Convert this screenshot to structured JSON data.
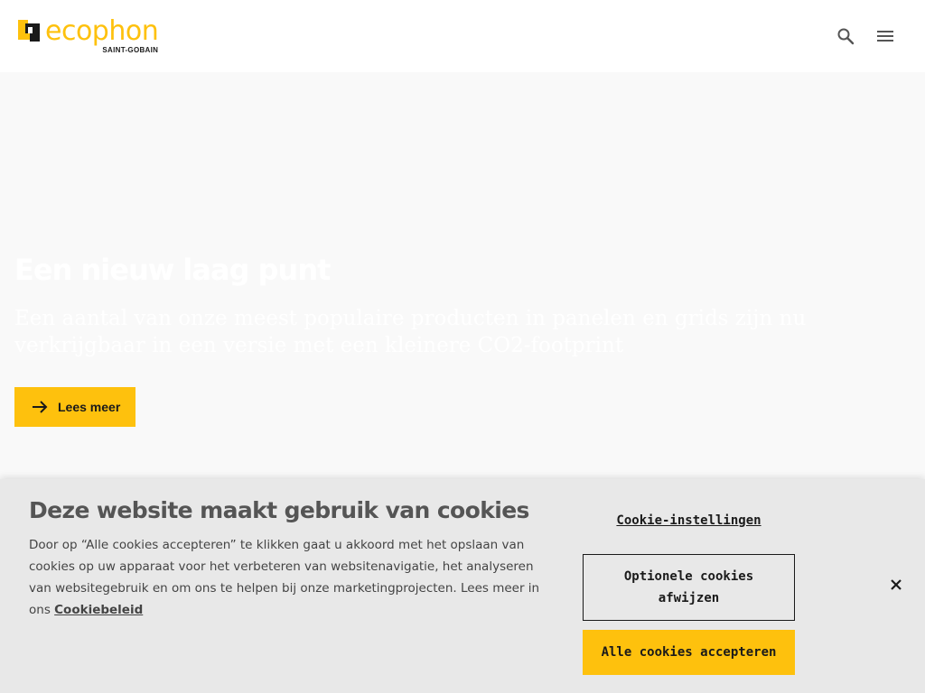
{
  "header": {
    "logo_word": "ecophon",
    "logo_sub": "SAINT-GOBAIN",
    "brand_color": "#fec10d",
    "search_icon": "search-icon",
    "menu_icon": "menu-icon"
  },
  "hero": {
    "title": "Een nieuw laag punt",
    "text": "Een aantal van onze meest populaire producten in panelen en grids zijn nu verkrijgbaar in een versie met een kleinere CO2-footprint",
    "button_label": "Lees meer",
    "button_icon": "arrow-right-icon"
  },
  "cookie_banner": {
    "title": "Deze website maakt gebruik van cookies",
    "body": "Door op “Alle cookies accepteren” te klikken gaat u akkoord met het opslaan van cookies op uw apparaat voor het verbeteren van websitenavigatie, het analyseren van websitegebruik en om ons te helpen bij onze marketingprojecten. Lees meer in ons ",
    "policy_link": "Cookiebeleid",
    "settings_link": "Cookie-instellingen",
    "reject_button": "Optionele cookies afwijzen",
    "accept_button": "Alle cookies accepteren",
    "close_icon": "close-icon"
  }
}
